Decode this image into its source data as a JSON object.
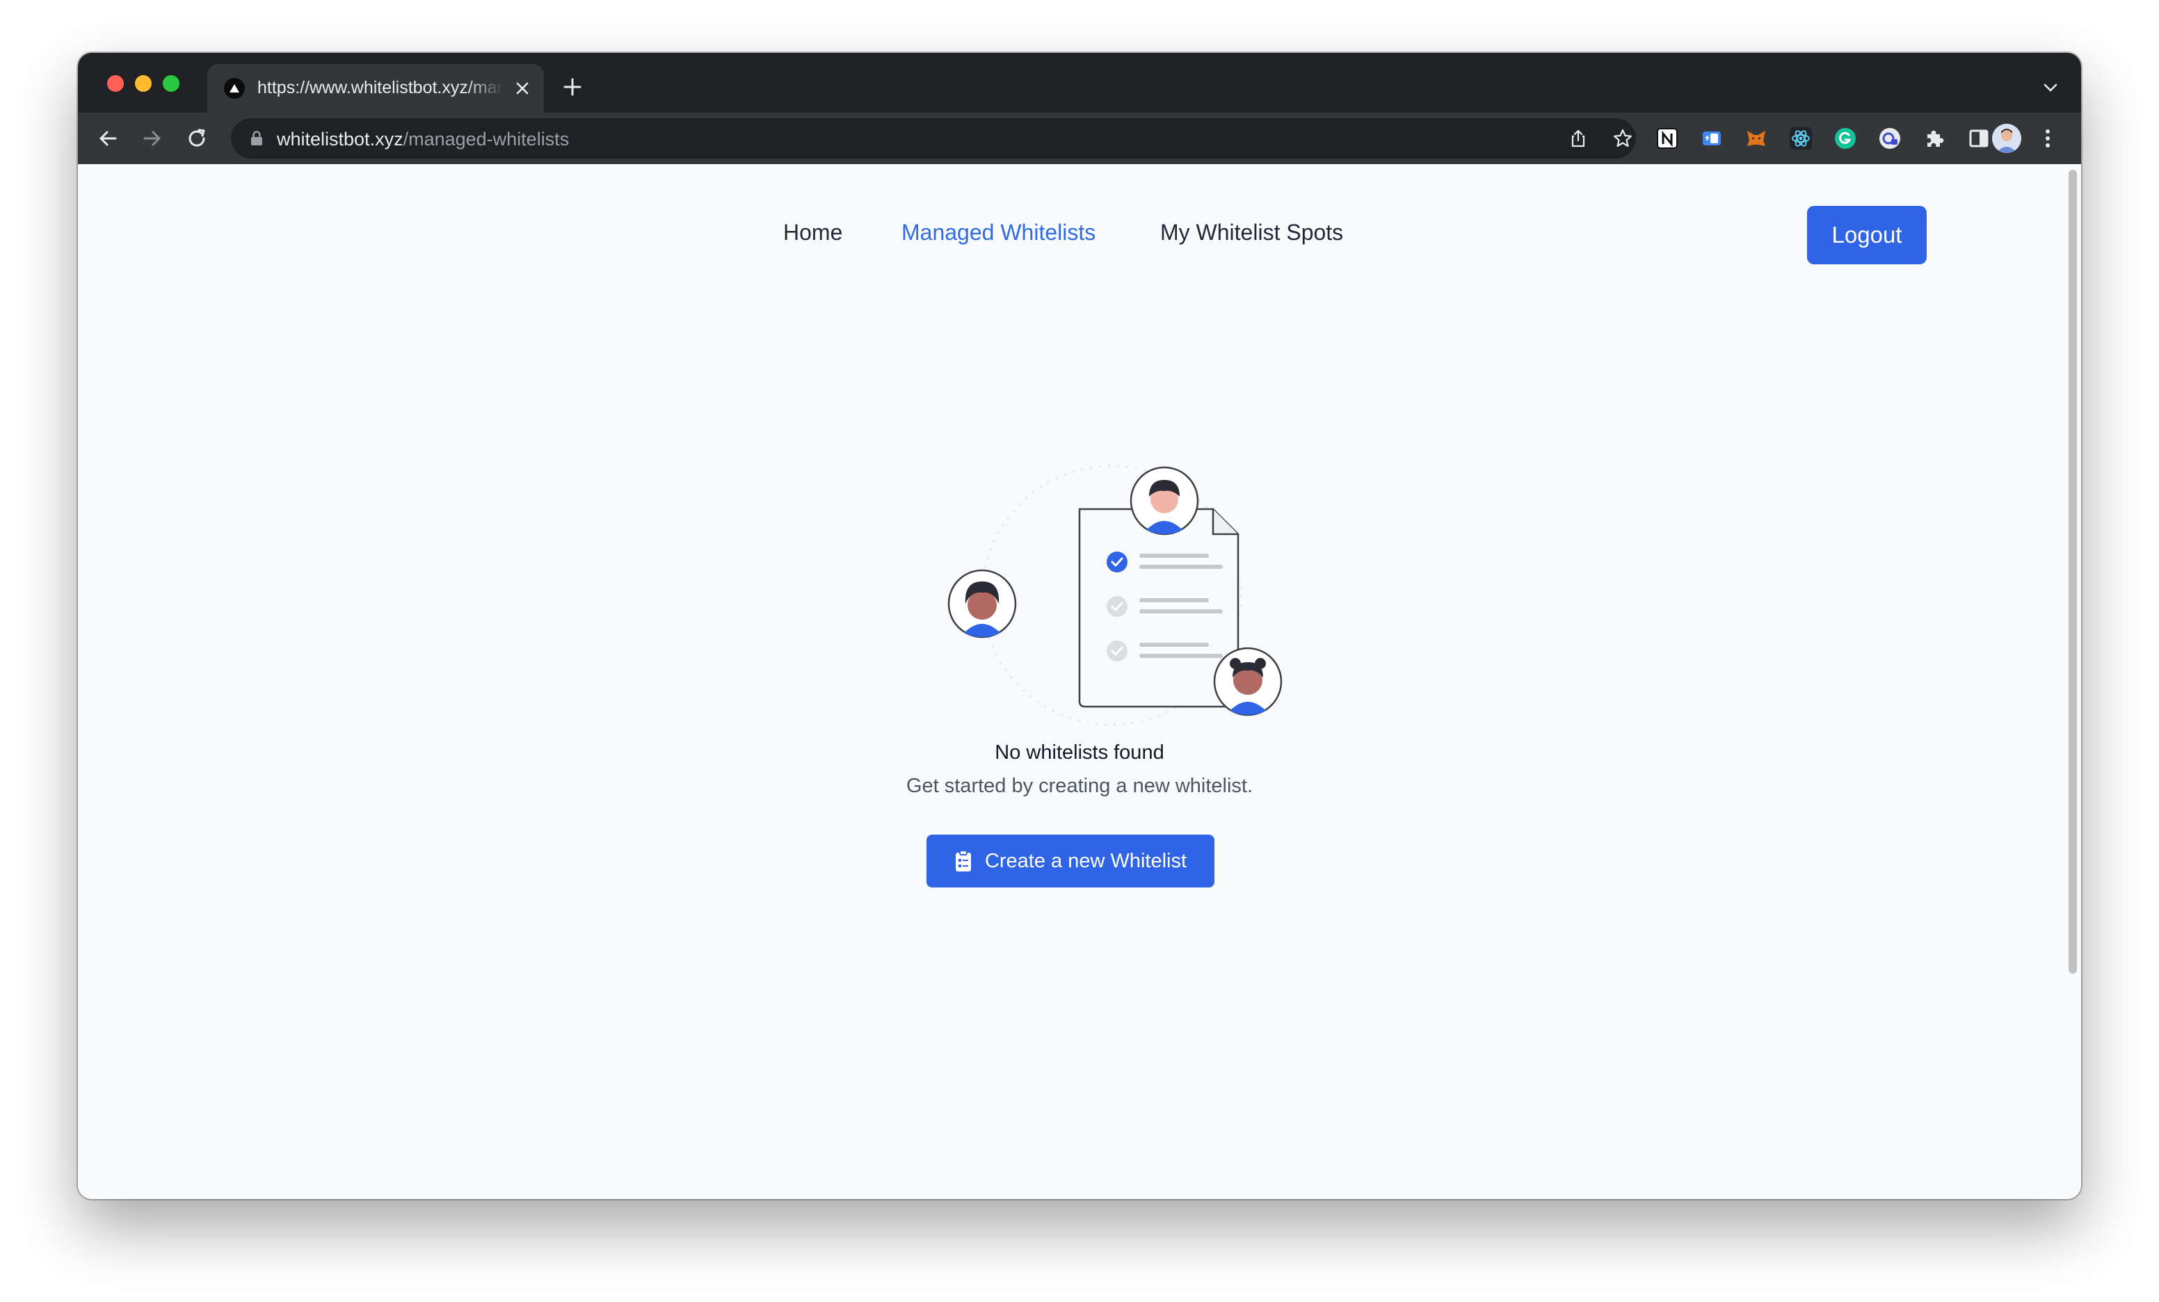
{
  "browser": {
    "tab": {
      "title": "https://www.whitelistbot.xyz/managed-whitelists",
      "favicon": "triangle-logo-icon"
    },
    "address_bar": {
      "host": "whitelistbot.xyz",
      "path": "/managed-whitelists"
    },
    "extensions": [
      "notion-icon",
      "translate-icon",
      "metamask-icon",
      "react-devtools-icon",
      "grammarly-icon",
      "camera-extension-icon",
      "puzzle-icon",
      "sidebar-icon"
    ]
  },
  "nav": {
    "home": "Home",
    "managed": "Managed Whitelists",
    "spots": "My Whitelist Spots",
    "logout": "Logout",
    "active_color": "#2f6ce5"
  },
  "empty_state": {
    "title": "No whitelists found",
    "subtitle": "Get started by creating a new whitelist.",
    "button": "Create a new Whitelist",
    "button_icon": "clipboard-icon"
  },
  "colors": {
    "primary": "#2f64e6",
    "page_bg": "#f8fafc",
    "chrome_dark": "#202124",
    "chrome_toolbar": "#35363a"
  }
}
